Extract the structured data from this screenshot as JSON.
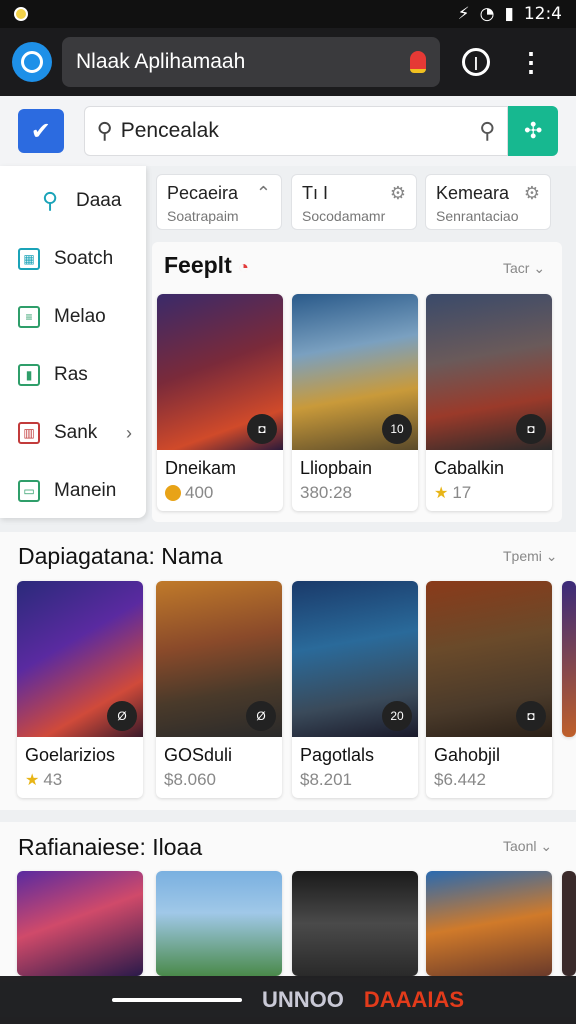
{
  "status": {
    "time": "12:4",
    "icons": [
      "signal-icon",
      "wifi-icon",
      "battery-icon"
    ]
  },
  "appbar": {
    "title": "Nlaak Aplihamaah"
  },
  "search": {
    "placeholder": "Pencealak"
  },
  "sidebar": {
    "items": [
      {
        "label": "Daaa",
        "icon": "search-icon"
      },
      {
        "label": "Soatch",
        "icon": "grid-icon"
      },
      {
        "label": "Melao",
        "icon": "list-icon"
      },
      {
        "label": "Ras",
        "icon": "chart-icon"
      },
      {
        "label": "Sank",
        "icon": "books-icon"
      },
      {
        "label": "Manein",
        "icon": "calendar-icon"
      }
    ]
  },
  "chips": [
    {
      "title": "Pecaeira",
      "sub": "Soatrapaim"
    },
    {
      "title": "Tı I",
      "sub": "Socodamamr"
    },
    {
      "title": "Kemeara",
      "sub": "Senrantaciao"
    }
  ],
  "section1": {
    "title": "Feeplt",
    "more": "Tacr",
    "cards": [
      {
        "name": "Dneikam",
        "meta": "400",
        "badge": "◘"
      },
      {
        "name": "Lliopbain",
        "meta": "380:28",
        "badge": "10"
      },
      {
        "name": "Cabalkin",
        "meta": "17",
        "badge": "◘"
      }
    ]
  },
  "section2": {
    "title": "Dapiagatana: Nama",
    "more": "Tpemi",
    "cards": [
      {
        "name": "Goelarizios",
        "meta": "43",
        "badge": "Ø"
      },
      {
        "name": "GOSduli",
        "meta": "$8.060",
        "badge": "Ø"
      },
      {
        "name": "Pagotlals",
        "meta": "$8.201",
        "badge": "20"
      },
      {
        "name": "Gahobjil",
        "meta": "$6.442",
        "badge": "◘"
      }
    ]
  },
  "section3": {
    "title": "Rafianaiese: Iloaa",
    "more": "Taonl"
  },
  "bottombar": {
    "logo_text": "UNNOO",
    "brand_text": "DAAAIAS"
  }
}
